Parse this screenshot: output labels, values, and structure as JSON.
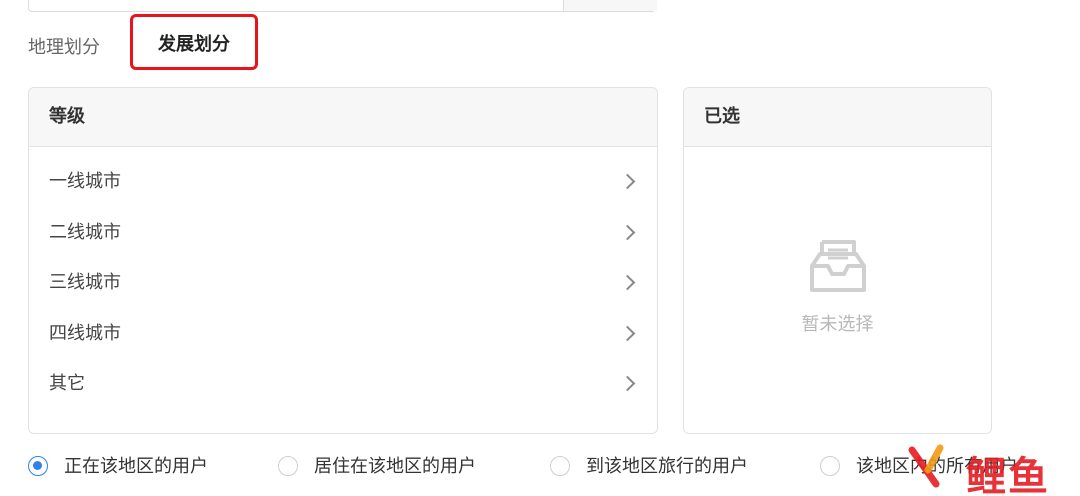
{
  "tabs": [
    {
      "label": "地理划分",
      "active": false
    },
    {
      "label": "发展划分",
      "active": true
    }
  ],
  "level_panel": {
    "header": "等级",
    "items": [
      "一线城市",
      "二线城市",
      "三线城市",
      "四线城市",
      "其它"
    ]
  },
  "selected_panel": {
    "header": "已选",
    "empty_text": "暂未选择",
    "empty_icon": "inbox-icon"
  },
  "radio_options": [
    {
      "label": "正在该地区的用户",
      "checked": true
    },
    {
      "label": "居住在该地区的用户",
      "checked": false
    },
    {
      "label": "到该地区旅行的用户",
      "checked": false
    },
    {
      "label": "该地区内的所有用户",
      "checked": false
    }
  ],
  "watermark": {
    "text": "鲤鱼"
  },
  "colors": {
    "highlight_border": "#e8141a",
    "radio_checked": "#2f80ed"
  }
}
